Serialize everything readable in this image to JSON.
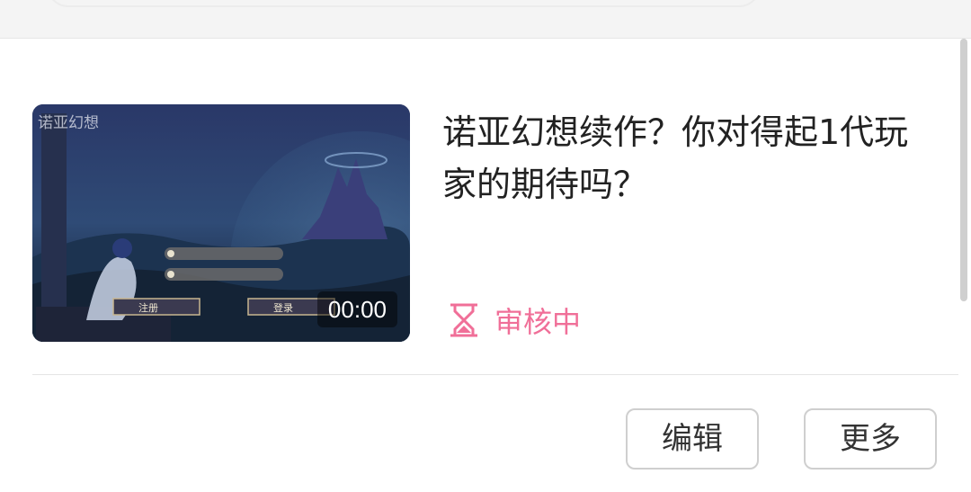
{
  "post": {
    "title": "诺亚幻想续作？你对得起1代玩家的期待吗？",
    "duration": "00:00",
    "status_label": "审核中",
    "status_icon": "hourglass-icon",
    "status_color": "#f06f98",
    "thumbnail": {
      "game_logo": "诺亚幻想",
      "register_label": "注册",
      "login_label": "登录"
    }
  },
  "actions": {
    "edit_label": "编辑",
    "more_label": "更多"
  }
}
